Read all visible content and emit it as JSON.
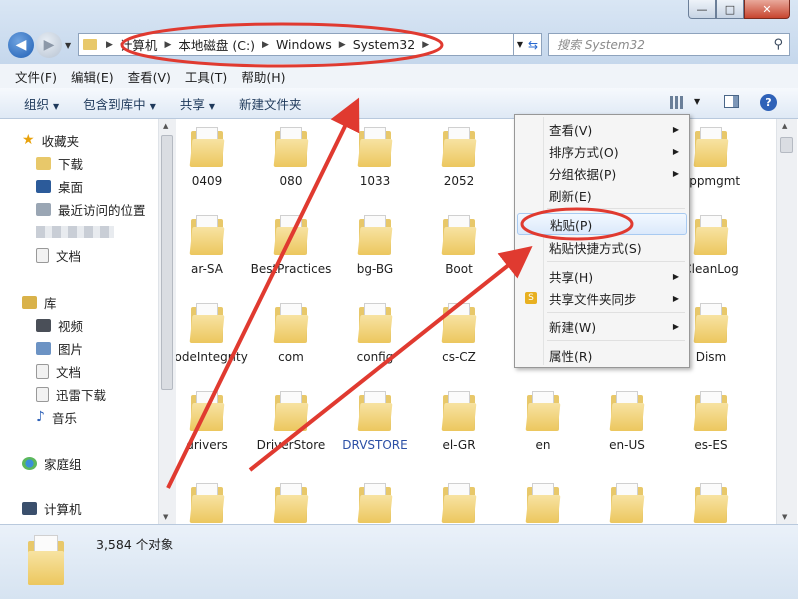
{
  "window": {
    "minimize": "—",
    "maximize": "□",
    "close": "✕"
  },
  "nav": {
    "back_icon": "back-arrow-icon",
    "forward_icon": "forward-arrow-icon"
  },
  "address": {
    "crumbs": [
      "计算机",
      "本地磁盘 (C:)",
      "Windows",
      "System32"
    ]
  },
  "search": {
    "placeholder": "搜索 System32"
  },
  "menubar": [
    "文件(F)",
    "编辑(E)",
    "查看(V)",
    "工具(T)",
    "帮助(H)"
  ],
  "toolbar": {
    "organize": "组织",
    "include_library": "包含到库中",
    "share": "共享",
    "new_folder": "新建文件夹"
  },
  "sidebar": {
    "favorites": "收藏夹",
    "downloads": "下载",
    "desktop": "桌面",
    "recent": "最近访问的位置",
    "documents_fav": "文档",
    "libraries": "库",
    "videos": "视频",
    "pictures": "图片",
    "documents": "文档",
    "xunlei": "迅雷下载",
    "music": "音乐",
    "homegroup": "家庭组",
    "computer": "计算机"
  },
  "folders": [
    {
      "name": "0409"
    },
    {
      "name": "080"
    },
    {
      "name": "1033"
    },
    {
      "name": "2052"
    },
    {
      "name": "appmgmt"
    },
    {
      "name": "ar-SA"
    },
    {
      "name": "BestPractices"
    },
    {
      "name": "bg-BG"
    },
    {
      "name": "Boot"
    },
    {
      "name": "CleanLog"
    },
    {
      "name": "CodeIntegrity"
    },
    {
      "name": "com"
    },
    {
      "name": "config"
    },
    {
      "name": "cs-CZ"
    },
    {
      "name": "Dism"
    },
    {
      "name": "drivers"
    },
    {
      "name": "DriverStore"
    },
    {
      "name": "DRVSTORE"
    },
    {
      "name": "el-GR"
    },
    {
      "name": "en"
    },
    {
      "name": "en-US"
    },
    {
      "name": "es-ES"
    }
  ],
  "context_menu": {
    "view": "查看(V)",
    "sort": "排序方式(O)",
    "group": "分组依据(P)",
    "refresh": "刷新(E)",
    "paste": "粘贴(P)",
    "paste_shortcut": "粘贴快捷方式(S)",
    "share": "共享(H)",
    "sync": "共享文件夹同步",
    "new": "新建(W)",
    "properties": "属性(R)"
  },
  "status": {
    "count": "3,584 个对象"
  },
  "colors": {
    "annotation": "#e03a30",
    "folder": "#ecc75e",
    "accent": "#1e395b"
  }
}
